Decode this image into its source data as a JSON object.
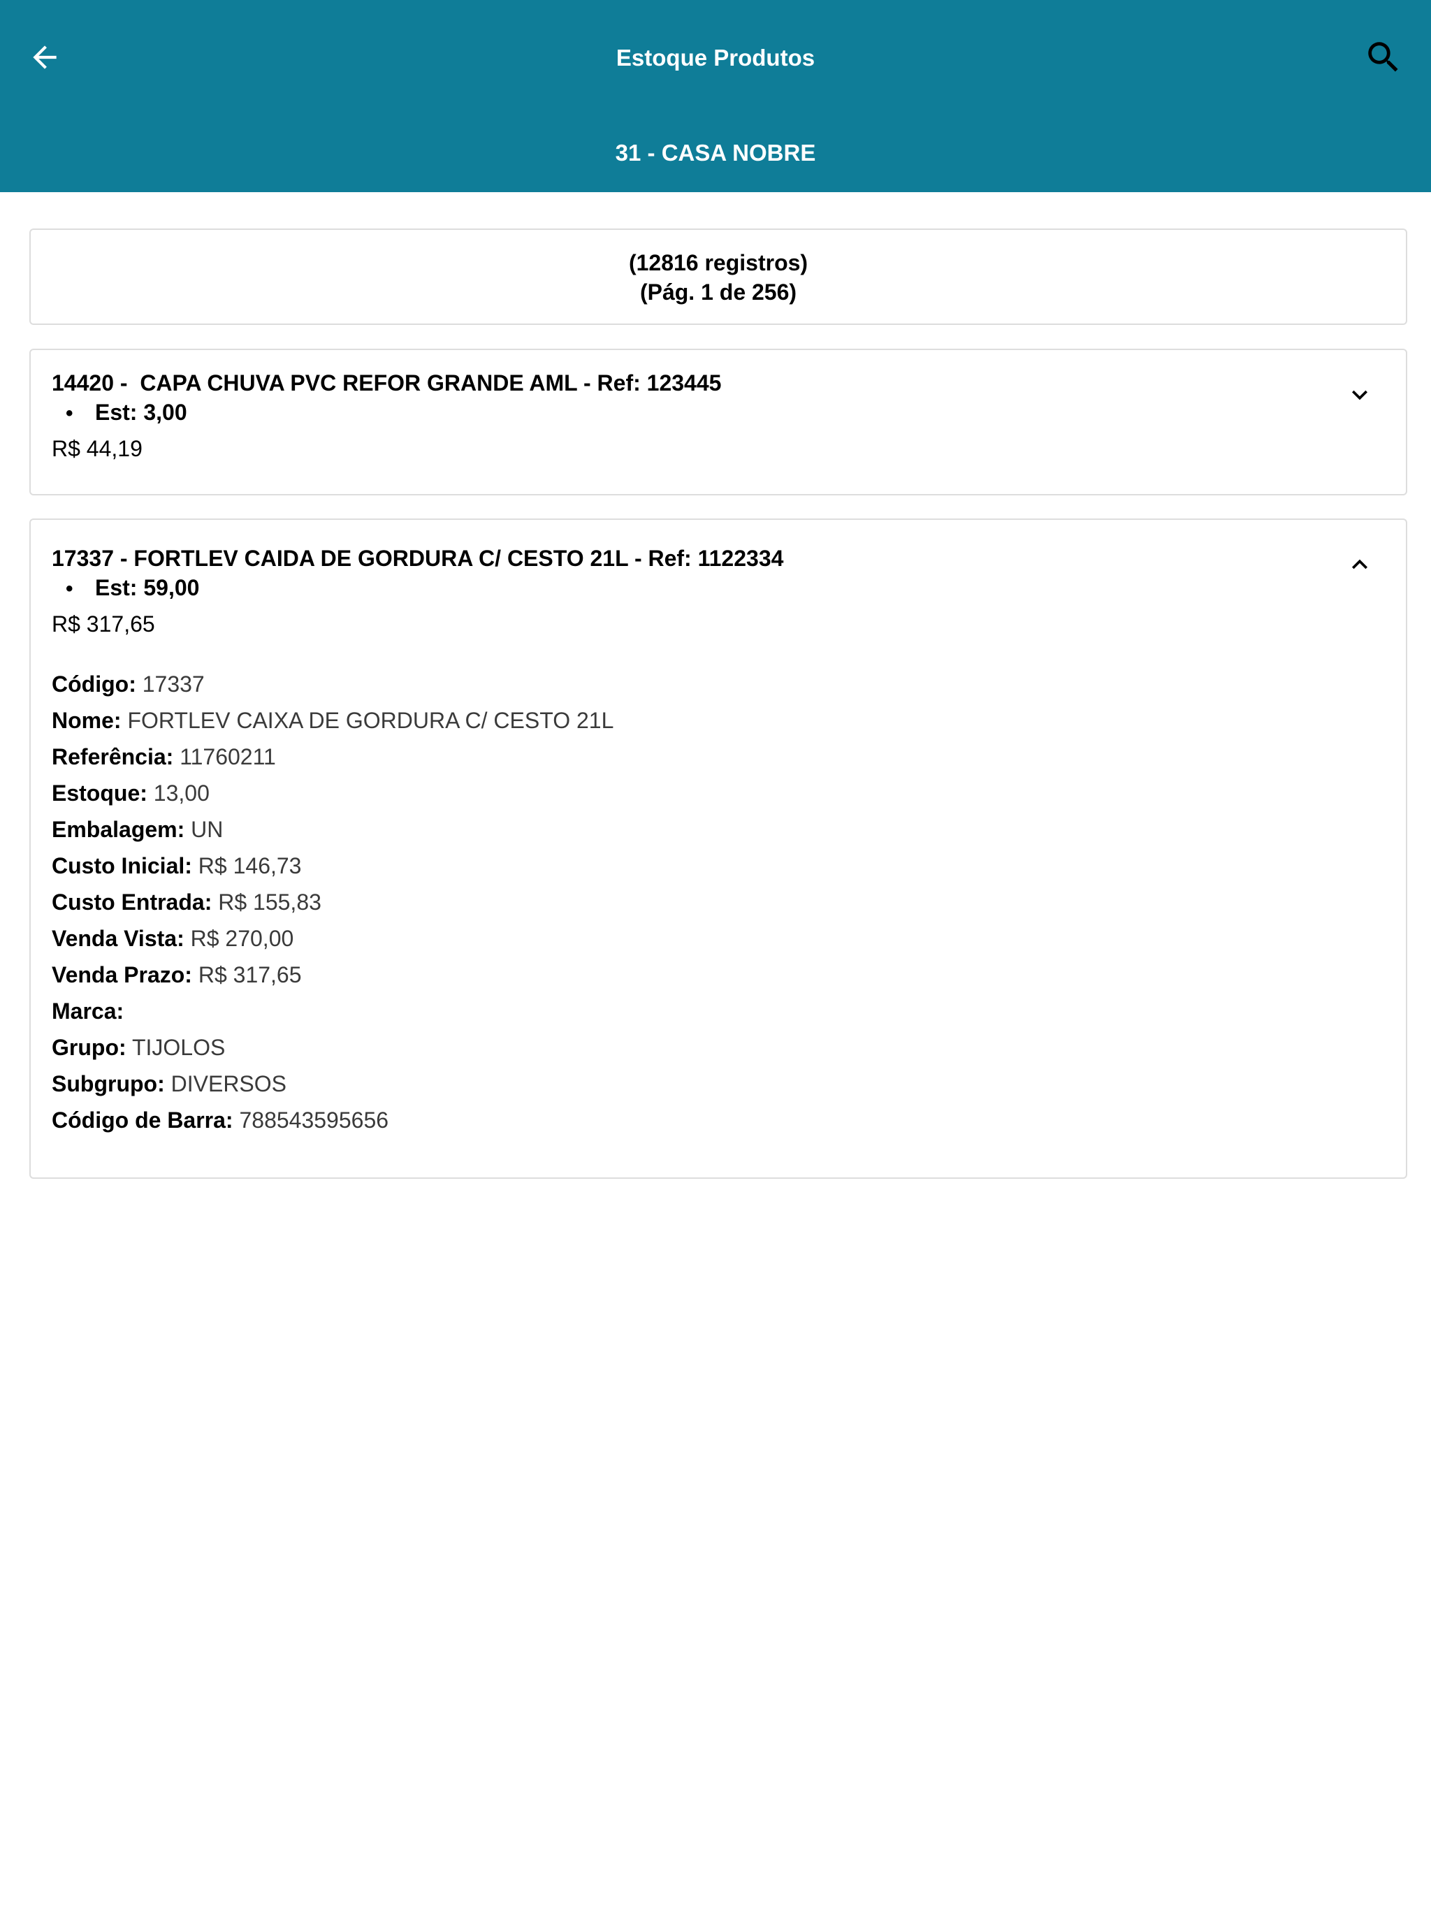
{
  "header": {
    "title": "Estoque Produtos",
    "subtitle": "31 - CASA NOBRE",
    "back_icon": "arrow-left-icon",
    "search_icon": "search-icon",
    "background_color": "#0f7d98"
  },
  "summary": {
    "records": "(12816 registros)",
    "page": "(Pág. 1 de 256)"
  },
  "products": [
    {
      "title": "14420 -  CAPA CHUVA PVC REFOR GRANDE AML - Ref: 123445",
      "stock": "Est: 3,00",
      "price": "R$ 44,19",
      "expanded": false,
      "toggle_icon": "chevron-down-icon"
    },
    {
      "title": "17337 - FORTLEV CAIDA DE GORDURA C/ CESTO 21L - Ref: 1122334",
      "stock": "Est: 59,00",
      "price": "R$ 317,65",
      "expanded": true,
      "toggle_icon": "chevron-up-icon",
      "details": [
        {
          "label": "Código:",
          "value": "17337"
        },
        {
          "label": "Nome:",
          "value": "FORTLEV CAIXA DE GORDURA C/ CESTO 21L"
        },
        {
          "label": "Referência:",
          "value": "11760211"
        },
        {
          "label": "Estoque:",
          "value": "13,00"
        },
        {
          "label": "Embalagem:",
          "value": "UN"
        },
        {
          "label": "Custo Inicial:",
          "value": "R$ 146,73"
        },
        {
          "label": "Custo Entrada:",
          "value": "R$ 155,83"
        },
        {
          "label": "Venda Vista:",
          "value": "R$ 270,00"
        },
        {
          "label": "Venda Prazo:",
          "value": "R$ 317,65"
        },
        {
          "label": "Marca:",
          "value": ""
        },
        {
          "label": "Grupo:",
          "value": "TIJOLOS"
        },
        {
          "label": "Subgrupo:",
          "value": "DIVERSOS"
        },
        {
          "label": "Código de Barra:",
          "value": "788543595656"
        }
      ]
    }
  ]
}
